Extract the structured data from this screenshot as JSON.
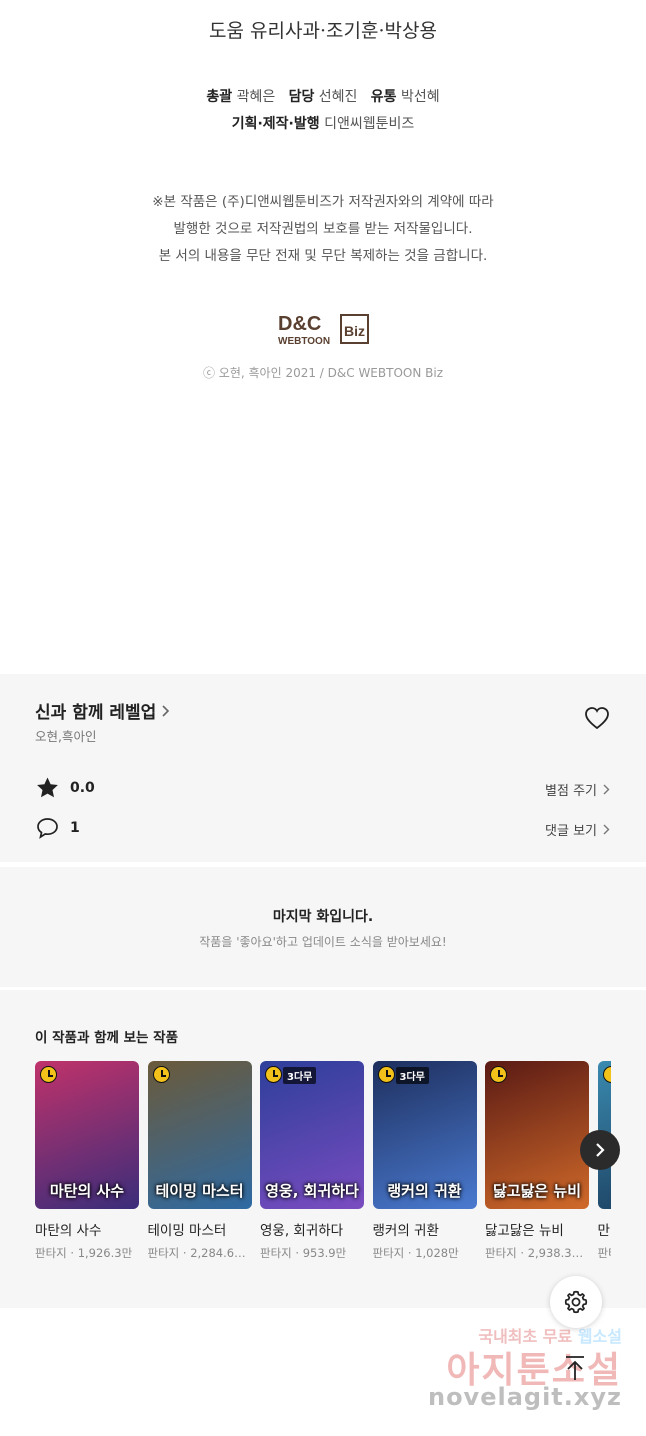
{
  "credits": {
    "assist": "도움 유리사과·조기훈·박상용",
    "staff_line1": [
      {
        "role": "총괄",
        "name": "곽혜은"
      },
      {
        "role": "담당",
        "name": "선혜진"
      },
      {
        "role": "유통",
        "name": "박선혜"
      }
    ],
    "staff_line2": {
      "role": "기획·제작·발행",
      "name": "디앤씨웹툰비즈"
    },
    "notice": [
      "※본 작품은 (주)디앤씨웹툰비즈가 저작권자와의 계약에 따라",
      "발행한 것으로 저작권법의 보호를 받는 저작물입니다.",
      "본 서의 내용을 무단 전재 및 무단 복제하는 것을 금합니다."
    ],
    "logo": {
      "top": "D&C",
      "bottom": "WEBTOON",
      "side": "Biz"
    },
    "copyright": "ⓒ 오현, 흑아인 2021 / D&C WEBTOON Biz"
  },
  "work": {
    "title": "신과 함께 레벨업",
    "authors": "오현,흑아인",
    "rating": "0.0",
    "rating_action": "별점 주기",
    "comments": "1",
    "comments_action": "댓글 보기"
  },
  "last_episode": {
    "title": "마지막 화입니다.",
    "subtitle": "작품을 '좋아요'하고 업데이트 소식을 받아보세요!"
  },
  "recommend": {
    "heading": "이 작품과 함께 보는 작품",
    "items": [
      {
        "name": "마탄의 사수",
        "meta": "판타지 · 1,926.3만",
        "badge": "",
        "cover_text": "마탄의 사수",
        "c1": "#c0326a",
        "c2": "#3a2d7a"
      },
      {
        "name": "테이밍 마스터",
        "meta": "판타지 · 2,284.6…",
        "badge": "",
        "cover_text": "테이밍 마스터",
        "c1": "#6b5a3a",
        "c2": "#2e6aa3"
      },
      {
        "name": "영웅, 회귀하다",
        "meta": "판타지 · 953.9만",
        "badge": "3다무",
        "cover_text": "영웅, 회귀하다",
        "c1": "#2d3f9a",
        "c2": "#7a4cc0"
      },
      {
        "name": "랭커의 귀환",
        "meta": "판타지 · 1,028만",
        "badge": "3다무",
        "cover_text": "랭커의 귀환",
        "c1": "#1e2f5e",
        "c2": "#4a7ad0"
      },
      {
        "name": "닳고닳은 뉴비",
        "meta": "판타지 · 2,938.3…",
        "badge": "",
        "cover_text": "닳고닳은 뉴비",
        "c1": "#5a1a14",
        "c2": "#d06a2a"
      },
      {
        "name": "만렙 귀환",
        "meta": "판타지",
        "badge": "",
        "cover_text": "",
        "c1": "#3a8ab0",
        "c2": "#1a3a5a"
      }
    ]
  },
  "watermark": {
    "line1_a": "국내최초 무료 ",
    "line1_b": "웹소설",
    "line2": "아지툰소설",
    "line3": "novelagit.xyz"
  },
  "icons": {
    "heart": "heart-icon",
    "star": "star-icon",
    "comment": "comment-icon",
    "chevron": "chevron-right-icon",
    "settings": "gear-icon",
    "top": "arrow-up-icon"
  }
}
